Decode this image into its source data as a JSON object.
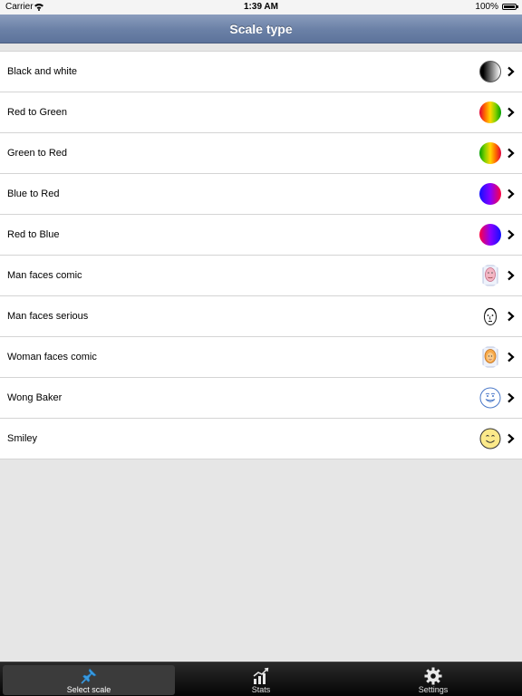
{
  "status_bar": {
    "carrier": "Carrier",
    "time": "1:39 AM",
    "battery": "100%"
  },
  "nav": {
    "title": "Scale type"
  },
  "scales": [
    {
      "label": "Black and white",
      "icon": "black-white-gradient-icon"
    },
    {
      "label": "Red to Green",
      "icon": "red-green-gradient-icon"
    },
    {
      "label": "Green to Red",
      "icon": "green-red-gradient-icon"
    },
    {
      "label": "Blue to Red",
      "icon": "blue-red-gradient-icon"
    },
    {
      "label": "Red to Blue",
      "icon": "red-blue-gradient-icon"
    },
    {
      "label": "Man faces comic",
      "icon": "man-face-comic-icon"
    },
    {
      "label": "Man faces serious",
      "icon": "man-face-serious-icon"
    },
    {
      "label": "Woman faces comic",
      "icon": "woman-face-comic-icon"
    },
    {
      "label": "Wong Baker",
      "icon": "wong-baker-face-icon"
    },
    {
      "label": "Smiley",
      "icon": "smiley-face-icon"
    }
  ],
  "tabs": [
    {
      "label": "Select scale",
      "icon": "pushpin-icon",
      "selected": true
    },
    {
      "label": "Stats",
      "icon": "bar-chart-icon",
      "selected": false
    },
    {
      "label": "Settings",
      "icon": "gear-icon",
      "selected": false
    }
  ],
  "colors": {
    "nav_bar": "#6a80a6",
    "tab_active_icon": "#3a9be0",
    "background": "#e6e6e6"
  }
}
